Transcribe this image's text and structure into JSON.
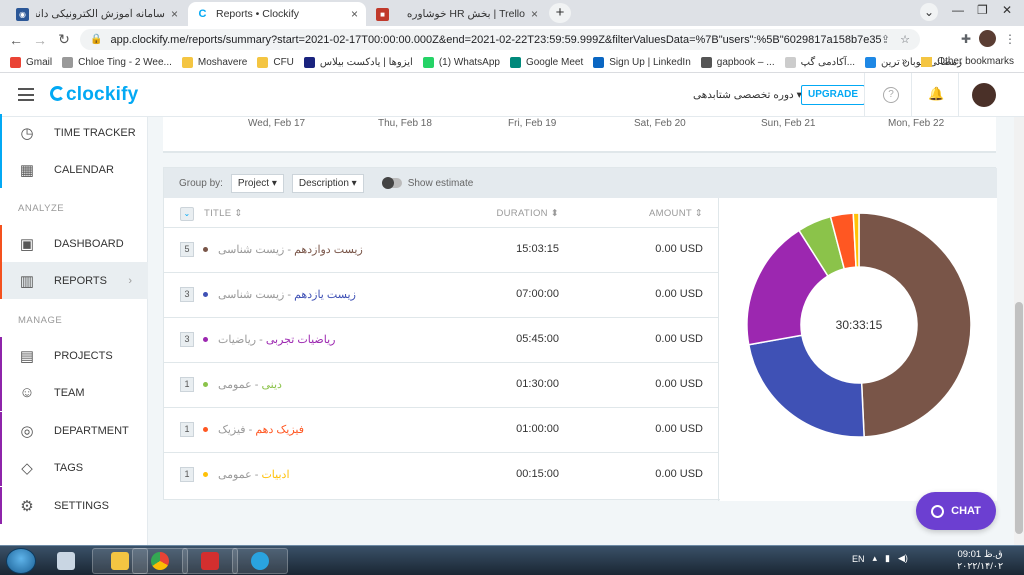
{
  "browser": {
    "tabs": [
      {
        "title": "سامانه آموزش الکترونیکی دانشگاه فرهنگیان",
        "color": "#2b5797"
      },
      {
        "title": "Reports • Clockify",
        "color": "#03a9f4"
      },
      {
        "title": "Trello | بخش HR خوشاوره",
        "color": "#c0392b"
      }
    ],
    "url": "app.clockify.me/reports/summary?start=2021-02-17T00:00:00.000Z&end=2021-02-22T23:59:59.999Z&filterValuesData=%7B\"users\":%5B\"6029817a158b7e35c8d30969\"...",
    "bookmarks": [
      {
        "label": "Gmail",
        "color": "#ea4335"
      },
      {
        "label": "Chloe Ting - 2 Wee...",
        "color": "#999999"
      },
      {
        "label": "Moshavere",
        "color": "#f4c542"
      },
      {
        "label": "CFU",
        "color": "#f4c542"
      },
      {
        "label": "ایزوها | یادکست بیلاس",
        "color": "#1a237e"
      },
      {
        "label": "(1) WhatsApp",
        "color": "#25d366"
      },
      {
        "label": "Google Meet",
        "color": "#00897b"
      },
      {
        "label": "Sign Up | LinkedIn",
        "color": "#0a66c2"
      },
      {
        "label": "gapbook – ...",
        "color": "#555555"
      },
      {
        "label": "آکادمی گپ...",
        "color": "#cccccc"
      },
      {
        "label": "رمضانی| بوبان ترین",
        "color": "#1e88e5"
      }
    ],
    "other_bookmarks": "Other bookmarks"
  },
  "app": {
    "logo": "clockify",
    "workspace": "دوره تخصصی شتابدهی",
    "upgrade": "UPGRADE",
    "sidebar": [
      {
        "label": "TIME TRACKER",
        "icon": "clock-icon",
        "glyph": "◷",
        "stripe": "#03a9f4"
      },
      {
        "label": "CALENDAR",
        "icon": "calendar-icon",
        "glyph": "▦",
        "stripe": "#03a9f4"
      },
      {
        "label": "DASHBOARD",
        "icon": "dashboard-icon",
        "glyph": "▣",
        "stripe": "#f4511e"
      },
      {
        "label": "REPORTS",
        "icon": "reports-icon",
        "glyph": "▥",
        "stripe": "#f4511e"
      },
      {
        "label": "PROJECTS",
        "icon": "projects-icon",
        "glyph": "▤",
        "stripe": "#8e24aa"
      },
      {
        "label": "TEAM",
        "icon": "team-icon",
        "glyph": "☺",
        "stripe": "#8e24aa"
      },
      {
        "label": "DEPARTMENT",
        "icon": "department-icon",
        "glyph": "◎",
        "stripe": "#8e24aa"
      },
      {
        "label": "TAGS",
        "icon": "tag-icon",
        "glyph": "◇",
        "stripe": "#8e24aa"
      },
      {
        "label": "SETTINGS",
        "icon": "settings-icon",
        "glyph": "⚙",
        "stripe": "#8e24aa"
      }
    ],
    "sections": {
      "analyze": "ANALYZE",
      "manage": "MANAGE"
    },
    "days": [
      "Wed, Feb 17",
      "Thu, Feb 18",
      "Fri, Feb 19",
      "Sat, Feb 20",
      "Sun, Feb 21",
      "Mon, Feb 22"
    ],
    "group_by": {
      "label": "Group by:",
      "project": "Project",
      "description": "Description",
      "estimate": "Show estimate"
    },
    "table": {
      "headers": {
        "title": "TITLE",
        "duration": "DURATION",
        "amount": "AMOUNT"
      },
      "rows": [
        {
          "count": "5",
          "project": "زیست دوازدهم",
          "client": "- زیست شناسی",
          "duration": "15:03:15",
          "amount": "0.00 USD",
          "color": "#795548"
        },
        {
          "count": "3",
          "project": "زیست یازدهم",
          "client": "- زیست شناسی",
          "duration": "07:00:00",
          "amount": "0.00 USD",
          "color": "#3f51b5"
        },
        {
          "count": "3",
          "project": "ریاضیات تجربی",
          "client": "- ریاضیات",
          "duration": "05:45:00",
          "amount": "0.00 USD",
          "color": "#9c27b0"
        },
        {
          "count": "1",
          "project": "دینی",
          "client": "- عمومی",
          "duration": "01:30:00",
          "amount": "0.00 USD",
          "color": "#8bc34a"
        },
        {
          "count": "1",
          "project": "فیزیک دهم",
          "client": "- فیزیک",
          "duration": "01:00:00",
          "amount": "0.00 USD",
          "color": "#ff5722"
        },
        {
          "count": "1",
          "project": "ادبیات",
          "client": "- عمومی",
          "duration": "00:15:00",
          "amount": "0.00 USD",
          "color": "#ffc107"
        }
      ]
    },
    "total": "30:33:15",
    "chat": "CHAT"
  },
  "chart_data": {
    "type": "pie",
    "categories": [
      "زیست دوازدهم",
      "زیست یازدهم",
      "ریاضیات تجربی",
      "دینی",
      "فیزیک دهم",
      "ادبیات"
    ],
    "values": [
      54195,
      25200,
      20700,
      5400,
      3600,
      900
    ],
    "colors": [
      "#795548",
      "#3f51b5",
      "#9c27b0",
      "#8bc34a",
      "#ff5722",
      "#ffc107"
    ],
    "center_label": "30:33:15"
  },
  "taskbar": {
    "lang": "EN",
    "time": "09:01 ق.ظ",
    "date": "۲۰۲۲/۱۴/۰۲"
  }
}
